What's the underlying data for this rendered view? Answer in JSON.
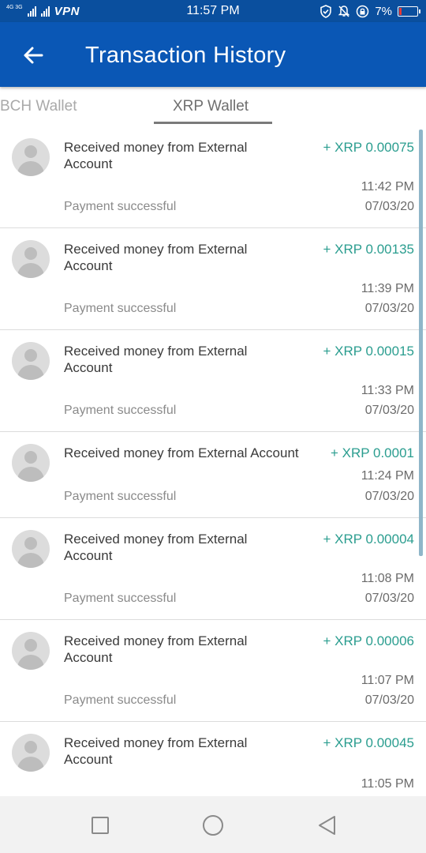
{
  "status_bar": {
    "network_label": "4G 3G",
    "vpn": "VPN",
    "time": "11:57 PM",
    "battery_percent": "7%"
  },
  "app_bar": {
    "title": "Transaction History"
  },
  "tabs": [
    {
      "label": "BCH Wallet",
      "selected": false
    },
    {
      "label": "XRP Wallet",
      "selected": true
    }
  ],
  "colors": {
    "status_bar": "#0a4f9e",
    "app_bar": "#0a57b5",
    "amount": "#2a9d8f"
  },
  "transactions": [
    {
      "line1": "Received money from External",
      "line2": "Account",
      "amount": "+ XRP 0.00075",
      "time": "11:42 PM",
      "status": "Payment successful",
      "date": "07/03/20"
    },
    {
      "line1": "Received money from External",
      "line2": "Account",
      "amount": "+ XRP 0.00135",
      "time": "11:39 PM",
      "status": "Payment successful",
      "date": "07/03/20"
    },
    {
      "line1": "Received money from External",
      "line2": "Account",
      "amount": "+ XRP 0.00015",
      "time": "11:33 PM",
      "status": "Payment successful",
      "date": "07/03/20"
    },
    {
      "line1": "Received money from External Account",
      "line2": "",
      "amount": "+ XRP 0.0001",
      "time": "11:24 PM",
      "status": "Payment successful",
      "date": "07/03/20"
    },
    {
      "line1": "Received money from External",
      "line2": "Account",
      "amount": "+ XRP 0.00004",
      "time": "11:08 PM",
      "status": "Payment successful",
      "date": "07/03/20"
    },
    {
      "line1": "Received money from External",
      "line2": "Account",
      "amount": "+ XRP 0.00006",
      "time": "11:07 PM",
      "status": "Payment successful",
      "date": "07/03/20"
    },
    {
      "line1": "Received money from External",
      "line2": "Account",
      "amount": "+ XRP 0.00045",
      "time": "11:05 PM",
      "status": "",
      "date": ""
    }
  ]
}
